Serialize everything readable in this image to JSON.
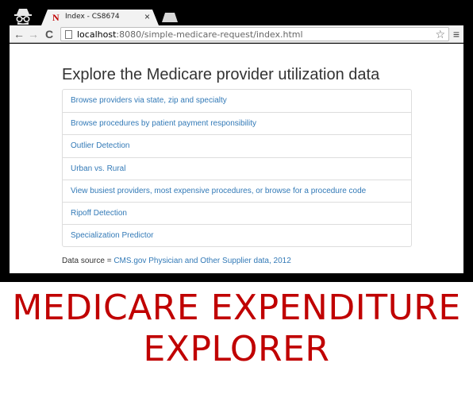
{
  "browser": {
    "tab_title": "Index - CS8674",
    "tab_favicon_letter": "N",
    "tab_close": "×",
    "url_host": "localhost",
    "url_rest": ":8080/simple-medicare-request/index.html",
    "back_glyph": "←",
    "forward_glyph": "→",
    "reload_glyph": "C",
    "star_glyph": "☆",
    "menu_glyph": "≡"
  },
  "page": {
    "title": "Explore the Medicare provider utilization data",
    "links": [
      "Browse providers via state, zip and specialty",
      "Browse procedures by patient payment responsibility",
      "Outlier Detection",
      "Urban vs. Rural",
      "View busiest providers, most expensive procedures, or browse for a procedure code",
      "Ripoff Detection",
      "Specialization Predictor"
    ],
    "source_label": "Data source = ",
    "source_link": "CMS.gov Physician and Other Supplier data, 2012"
  },
  "caption": {
    "line1": "MEDICARE EXPENDITURE",
    "line2": "EXPLORER"
  },
  "colors": {
    "caption": "#c00000",
    "link": "#337ab7",
    "frame": "#000000"
  }
}
